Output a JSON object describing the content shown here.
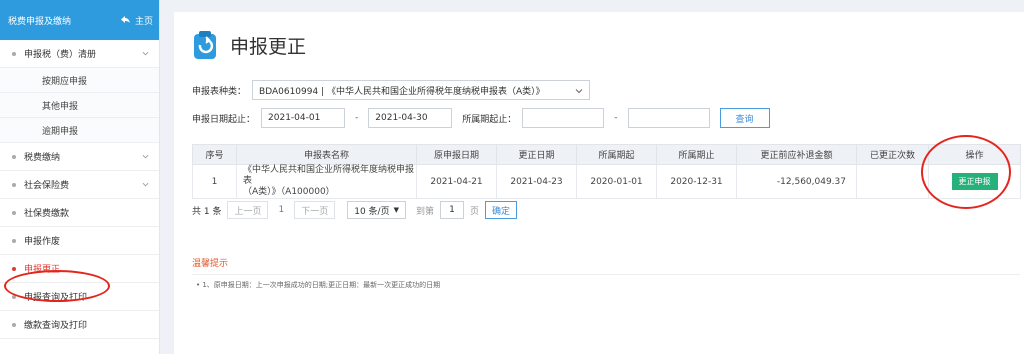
{
  "sidebar": {
    "header": "税费申报及缴纳",
    "home_label": "主页",
    "items": [
      {
        "label": "申报税（费）清册",
        "expandable": true
      },
      {
        "label": "按期应申报",
        "sub": true
      },
      {
        "label": "其他申报",
        "sub": true
      },
      {
        "label": "逾期申报",
        "sub": true
      },
      {
        "label": "税费缴纳",
        "expandable": true
      },
      {
        "label": "社会保险费",
        "expandable": true
      },
      {
        "label": "社保费缴款"
      },
      {
        "label": "申报作废"
      },
      {
        "label": "申报更正",
        "active": true
      },
      {
        "label": "申报查询及打印"
      },
      {
        "label": "缴款查询及打印"
      }
    ]
  },
  "main": {
    "title": "申报更正",
    "form_type_label": "申报表种类：",
    "form_type_value": "BDA0610994 | 《中华人民共和国企业所得税年度纳税申报表（A类）》",
    "date_label": "申报日期起止：",
    "date_from": "2021-04-01",
    "date_to": "2021-04-30",
    "dash": "-",
    "period_label": "所属期起止：",
    "period_from": "",
    "period_to": "",
    "query_button": "查询"
  },
  "table": {
    "headers": [
      "序号",
      "申报表名称",
      "原申报日期",
      "更正日期",
      "所属期起",
      "所属期止",
      "更正前应补退金额",
      "已更正次数",
      "操作"
    ],
    "row": {
      "index": "1",
      "name_line1": "《中华人民共和国企业所得税年度纳税申报表",
      "name_line2": "（A类）》（A100000）",
      "orig_date": "2021-04-21",
      "corr_date": "2021-04-23",
      "period_from": "2020-01-01",
      "period_to": "2020-12-31",
      "amount": "-12,560,049.37",
      "count": "",
      "action": "更正申报"
    }
  },
  "pager": {
    "total": "共 1 条",
    "prev": "上一页",
    "page": "1",
    "next": "下一页",
    "page_size": "10 条/页",
    "goto_label": "到第",
    "goto_value": "1",
    "page_unit": "页",
    "confirm": "确定"
  },
  "tips": {
    "title": "温馨提示",
    "text": "• 1、原申报日期：上一次申报成功的日期;更正日期：最新一次更正成功的日期"
  },
  "colors": {
    "sidebar_header": "#2e9bdf",
    "active": "#e03a2f",
    "action_button": "#26b07a",
    "link": "#3a8ad8",
    "annotation": "#e3261c"
  }
}
